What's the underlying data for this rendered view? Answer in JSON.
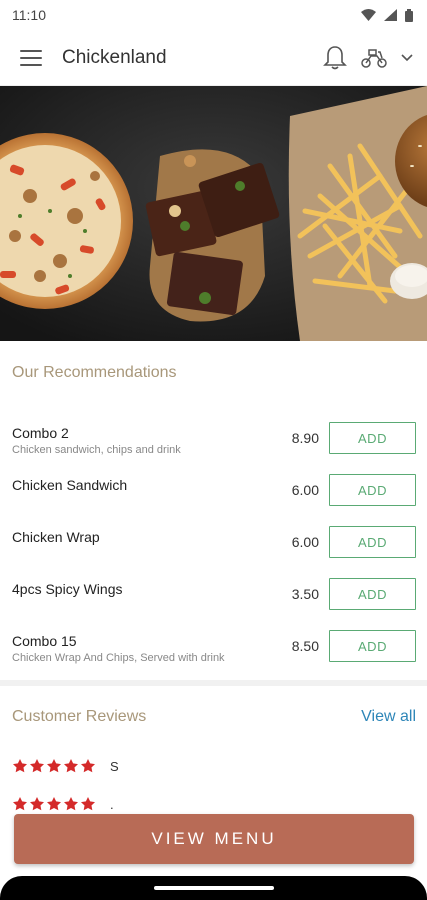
{
  "status_bar": {
    "time": "11:10",
    "icons": [
      "wifi-icon",
      "signal-icon",
      "battery-icon"
    ]
  },
  "app_bar": {
    "title": "Chickenland",
    "icons": [
      "menu-icon",
      "bell-icon",
      "delivery-scooter-icon",
      "chevron-down-icon"
    ]
  },
  "hero": {
    "description_icons": [
      "pizza",
      "brownies",
      "fries",
      "burger"
    ]
  },
  "recommendations": {
    "title": "Our Recommendations",
    "items": [
      {
        "name": "Combo 2",
        "description": "Chicken sandwich, chips and drink",
        "price": "8.90",
        "button": "ADD"
      },
      {
        "name": "Chicken Sandwich",
        "description": "",
        "price": "6.00",
        "button": "ADD"
      },
      {
        "name": "Chicken Wrap",
        "description": "",
        "price": "6.00",
        "button": "ADD"
      },
      {
        "name": "4pcs Spicy Wings",
        "description": "",
        "price": "3.50",
        "button": "ADD"
      },
      {
        "name": "Combo 15",
        "description": "Chicken Wrap And Chips, Served with drink",
        "price": "8.50",
        "button": "ADD"
      }
    ]
  },
  "reviews": {
    "title": "Customer Reviews",
    "view_all": "View all",
    "entries": [
      {
        "stars": 5,
        "text": "S"
      },
      {
        "stars": 5,
        "text": "."
      }
    ]
  },
  "cta": {
    "label": "VIEW MENU"
  },
  "colors": {
    "accent_green": "#5aaa74",
    "cta_brown": "#b86b56",
    "section_title": "#a8977a",
    "link_blue": "#2e86b8",
    "star_red": "#d42a2a"
  }
}
